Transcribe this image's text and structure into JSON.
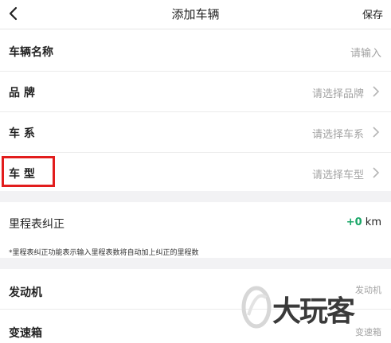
{
  "nav": {
    "title": "添加车辆",
    "save_label": "保存"
  },
  "form": {
    "name": {
      "label": "车辆名称",
      "placeholder": "请输入"
    },
    "brand": {
      "label": "品 牌",
      "placeholder": "请选择品牌"
    },
    "series": {
      "label": "车 系",
      "placeholder": "请选择车系"
    },
    "model": {
      "label": "车 型",
      "placeholder": "请选择车型"
    }
  },
  "odometer": {
    "label": "里程表纠正",
    "plus": "+0",
    "unit": " km",
    "note": "*里程表纠正功能表示输入里程表数将自动加上纠正的里程数"
  },
  "engine": {
    "label": "发动机",
    "value": "发动机"
  },
  "gearbox": {
    "label": "变速箱",
    "value": "变速箱"
  },
  "watermark": {
    "text": "大玩客"
  },
  "colors": {
    "highlight": "#e21d1d",
    "accent_green": "#19a667",
    "placeholder": "#a3a3a3",
    "background": "#f2f2f4"
  }
}
